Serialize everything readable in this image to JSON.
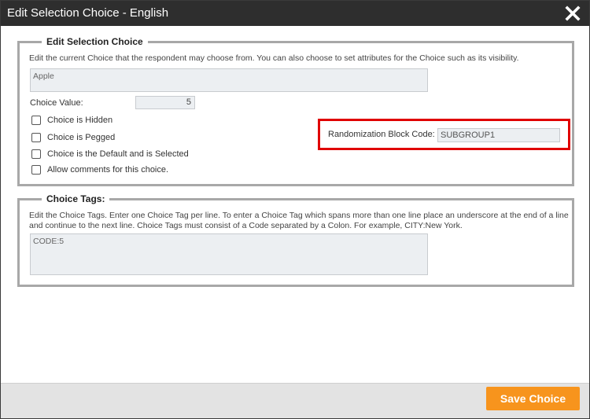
{
  "dialog": {
    "title": "Edit Selection Choice  -  English"
  },
  "choice_section": {
    "legend": "Edit Selection Choice",
    "description": "Edit the current Choice that the respondent may choose from. You can also choose to set attributes for the Choice such as its visibility.",
    "choice_text": "Apple",
    "choice_value_label": "Choice Value:",
    "choice_value": "5",
    "checkboxes": [
      {
        "label": "Choice is Hidden",
        "checked": false
      },
      {
        "label": "Choice is Pegged",
        "checked": false
      },
      {
        "label": "Choice is the Default and is Selected",
        "checked": false
      },
      {
        "label": "Allow comments for this choice.",
        "checked": false
      }
    ],
    "randomization_label": "Randomization Block Code:",
    "randomization_value": "SUBGROUP1"
  },
  "tags_section": {
    "legend": "Choice Tags:",
    "description": "Edit the Choice Tags. Enter one Choice Tag per line. To enter a Choice Tag which spans more than one line place an underscore at the end of a line and continue to the next line. Choice Tags must consist of a Code separated by a Colon. For example, CITY:New York.",
    "tags_text": "CODE:5"
  },
  "footer": {
    "save_label": "Save Choice"
  },
  "colors": {
    "titlebar": "#2e2e2e",
    "accent": "#f7941d",
    "highlight": "#e00000"
  }
}
